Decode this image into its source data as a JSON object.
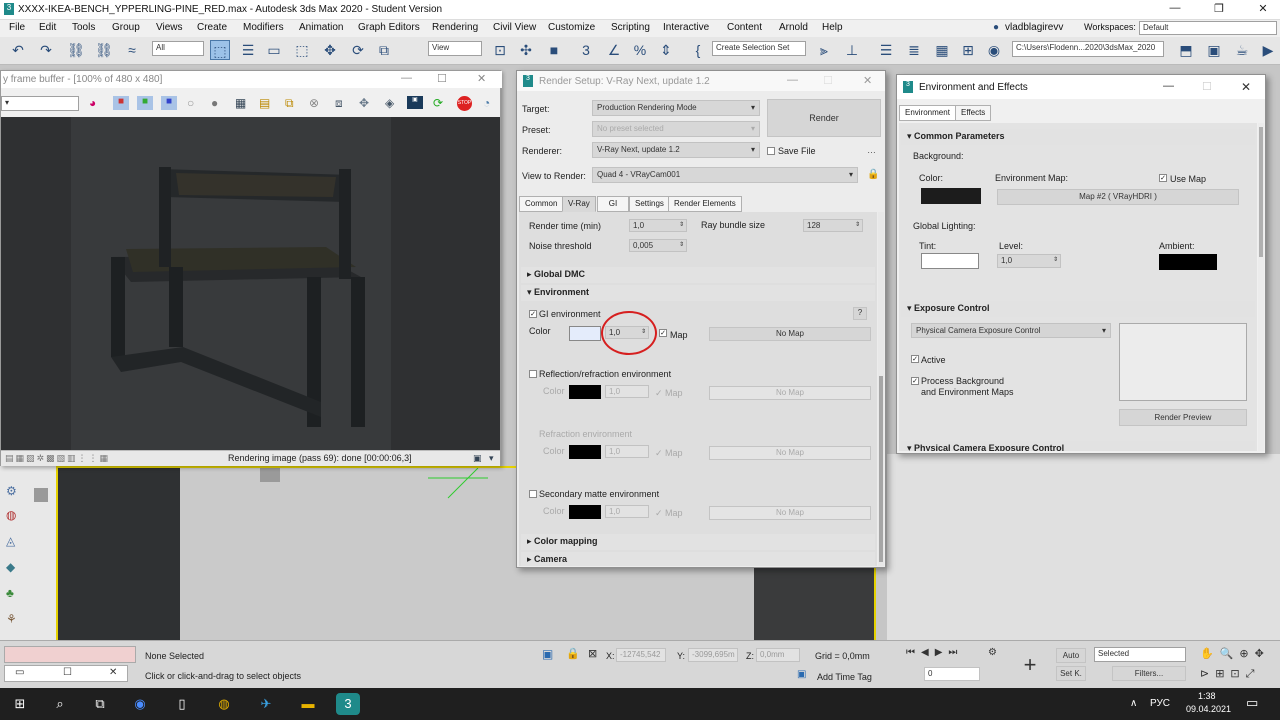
{
  "app": {
    "title": "XXXX-IKEA-BENCH_YPPERLING-PINE_RED.max - Autodesk 3ds Max 2020 - Student Version",
    "menu": [
      "File",
      "Edit",
      "Tools",
      "Group",
      "Views",
      "Create",
      "Modifiers",
      "Animation",
      "Graph Editors",
      "Rendering",
      "Civil View",
      "Customize",
      "Scripting",
      "Interactive",
      "Content",
      "Arnold",
      "Help"
    ],
    "user": "vladblagirevv",
    "workspaces_label": "Workspaces:",
    "workspace_value": "Default",
    "selection_filter": "All",
    "view_combo": "View",
    "create_selection_set": "Create Selection Set",
    "path": "C:\\Users\\Flodenn...2020\\3dsMax_2020"
  },
  "vfb": {
    "title": "y frame buffer - [100% of 480 x 480]",
    "status_text": "Rendering image (pass 69): done [00:00:06,3]"
  },
  "render_setup": {
    "title": "Render Setup: V-Ray Next, update 1.2",
    "target_label": "Target:",
    "target_value": "Production Rendering Mode",
    "preset_label": "Preset:",
    "preset_value": "No preset selected",
    "renderer_label": "Renderer:",
    "renderer_value": "V-Ray Next, update 1.2",
    "save_file": "Save File",
    "view_label": "View to Render:",
    "view_value": "Quad 4 - VRayCam001",
    "render_button": "Render",
    "tabs": [
      "Common",
      "V-Ray",
      "GI",
      "Settings",
      "Render Elements"
    ],
    "render_time_label": "Render time (min)",
    "render_time_value": "1,0",
    "ray_bundle_label": "Ray bundle size",
    "ray_bundle_value": "128",
    "noise_label": "Noise threshold",
    "noise_value": "0,005",
    "global_dmc": "Global DMC",
    "environment": "Environment",
    "gi_env": "GI environment",
    "color_label": "Color",
    "gi_mult": "1,0",
    "map_label": "Map",
    "no_map": "No Map",
    "help_q": "?",
    "refl_env": "Reflection/refraction environment",
    "refr_env": "Refraction environment",
    "sec_matte": "Secondary matte environment",
    "color_mapping": "Color mapping",
    "camera": "Camera"
  },
  "env_effects": {
    "title": "Environment and Effects",
    "tabs": [
      "Environment",
      "Effects"
    ],
    "common_params": "Common Parameters",
    "background": "Background:",
    "color": "Color:",
    "env_map": "Environment Map:",
    "use_map": "Use Map",
    "map_button": "Map #2  ( VRayHDRI )",
    "global_lighting": "Global Lighting:",
    "tint": "Tint:",
    "level": "Level:",
    "level_value": "1,0",
    "ambient": "Ambient:",
    "exposure_control": "Exposure Control",
    "exposure_value": "Physical Camera Exposure Control",
    "active": "Active",
    "process_bg": "Process Background",
    "process_bg2": "and Environment Maps",
    "render_preview": "Render Preview",
    "physical_camera": "Physical Camera Exposure Control"
  },
  "status_bar": {
    "none_selected": "None Selected",
    "hint": "Click or click-and-drag to select objects",
    "x_label": "X:",
    "x_value": "-12745,542",
    "y_label": "Y:",
    "y_value": "-3099,695m",
    "z_label": "Z:",
    "z_value": "0,0mm",
    "grid": "Grid = 0,0mm",
    "add_time_tag": "Add Time Tag",
    "auto": "Auto",
    "set_k": "Set K.",
    "selected": "Selected",
    "filters": "Filters...",
    "frame": "0"
  },
  "taskbar": {
    "lang": "РУС",
    "time": "1:38",
    "date": "09.04.2021"
  },
  "colors": {
    "accent": "#2a4d7a",
    "highlight_circle": "#d61f1f"
  }
}
